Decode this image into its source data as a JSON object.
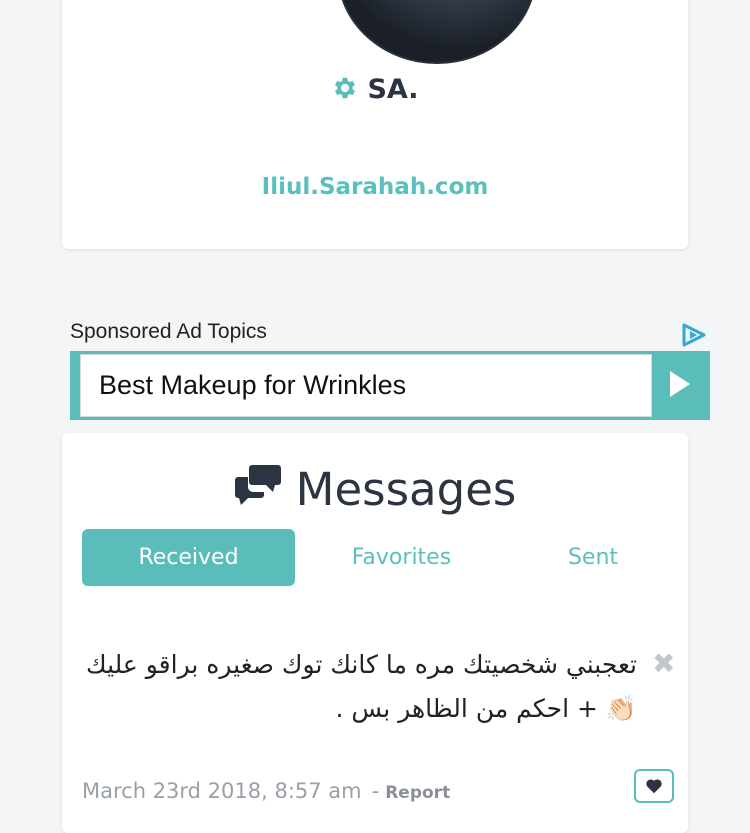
{
  "profile": {
    "name": "SA.",
    "url": "Iliul.Sarahah.com"
  },
  "ad": {
    "title": "Sponsored Ad Topics",
    "text": "Best Makeup for Wrinkles"
  },
  "messages": {
    "header": "Messages",
    "tabs": [
      {
        "label": "Received",
        "active": true
      },
      {
        "label": "Favorites",
        "active": false
      },
      {
        "label": "Sent",
        "active": false
      }
    ],
    "items": [
      {
        "text": "تعجبني شخصيتك مره ما كانك توك صغيره براقو عليك 👏🏻 + احكم من الظاهر بس .",
        "close_symbol": "✖",
        "date": "March 23rd 2018, 8:57 am",
        "separator": "-",
        "report_label": "Report"
      }
    ]
  },
  "colors": {
    "accent": "#5bbdb9",
    "text_dark": "#2b3440",
    "background": "#f4f5f7"
  }
}
